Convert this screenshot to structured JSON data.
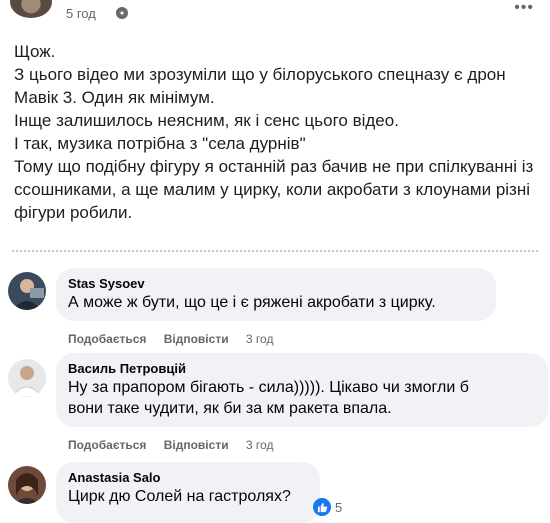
{
  "post": {
    "time": "5 год",
    "lines": [
      "Щож.",
      "З цього відео ми зрозуміли що у білоруського спецназу є дрон",
      "Мавік 3. Один як мінімум.",
      "Інще залишилось неясним, як і сенс цього відео.",
      "І так, музика потрібна з \"села дурнів\"",
      "Тому що подібну фігуру я останній раз бачив не при спілкуванні із",
      "ссошниками, а ще малим у цирку, коли акробати з клоунами різні",
      "фігури робили."
    ]
  },
  "comments": [
    {
      "name": "Stas Sysoev",
      "text_lines": [
        "А може ж бути, що це і є ряжені акробати з цирку."
      ],
      "like_label": "Подобається",
      "reply_label": "Відповісти",
      "time": "3 год"
    },
    {
      "name": "Василь Петровцій",
      "text_lines": [
        "Ну за прапором бігають - сила))))). Цікаво чи змогли б",
        "вони таке чудити, як би за км ракета впала."
      ],
      "like_label": "Подобається",
      "reply_label": "Відповісти",
      "time": "3 год"
    },
    {
      "name": "Anastasia Salo",
      "text_lines": [
        "Цирк дю Солей на гастролях?"
      ],
      "reaction_count": "5"
    }
  ],
  "icons": {
    "privacy": "globe-icon",
    "more": "more-dots-icon",
    "reaction": [
      "like-icon",
      "wow-icon"
    ]
  },
  "colors": {
    "bubble": "#f0f2f5",
    "secondary_text": "#65676b",
    "like_blue": "#1877f2"
  }
}
